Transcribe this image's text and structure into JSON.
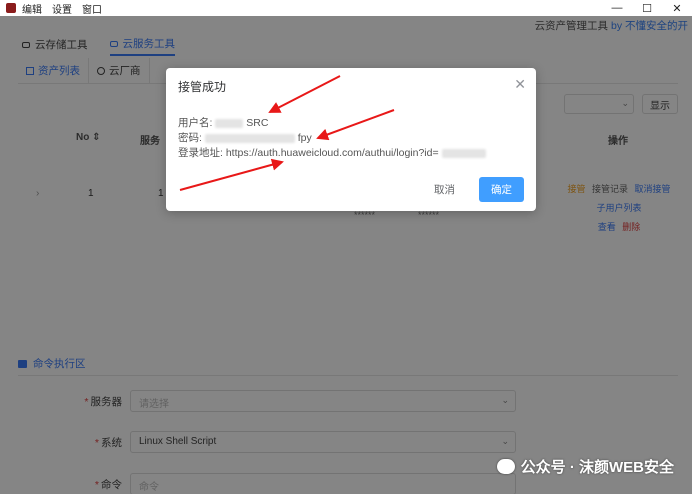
{
  "menu": [
    "编辑",
    "设置",
    "窗口"
  ],
  "brand": {
    "text": "云资产管理工具",
    "by": "by 不懂安全的开"
  },
  "top_tabs": [
    {
      "label": "云存储工具"
    },
    {
      "label": "云服务工具"
    }
  ],
  "sub_tabs": [
    {
      "label": "资产列表"
    },
    {
      "label": "云厂商"
    }
  ],
  "toolbar": {
    "show_label": "显示"
  },
  "table": {
    "headers": {
      "no": "No",
      "server": "服务"
    },
    "ops_header": "操作",
    "row": {
      "no": "1",
      "server": "1",
      "mask_a": "******",
      "mask_b": "******"
    },
    "ops": {
      "takeover": "接管",
      "takeover_log": "接管记录",
      "cancel_takeover": "取消接管",
      "subusers": "子用户列表",
      "view": "查看",
      "delete": "删除"
    }
  },
  "cmd": {
    "title": "命令执行区",
    "server_label": "服务器",
    "server_placeholder": "请选择",
    "system_label": "系统",
    "system_value": "Linux Shell Script",
    "command_label": "命令",
    "command_placeholder": "命令"
  },
  "dialog": {
    "title": "接管成功",
    "username_label": "用户名:",
    "username_value": "SRC",
    "password_label": "密码:",
    "password_value": "fpy",
    "login_label": "登录地址:",
    "login_url": "https://auth.huaweicloud.com/authui/login?id=",
    "cancel": "取消",
    "ok": "确定"
  },
  "watermark": "公众号 · 沫颜WEB安全",
  "colors": {
    "accent": "#409eff",
    "arrow": "#e81818"
  }
}
